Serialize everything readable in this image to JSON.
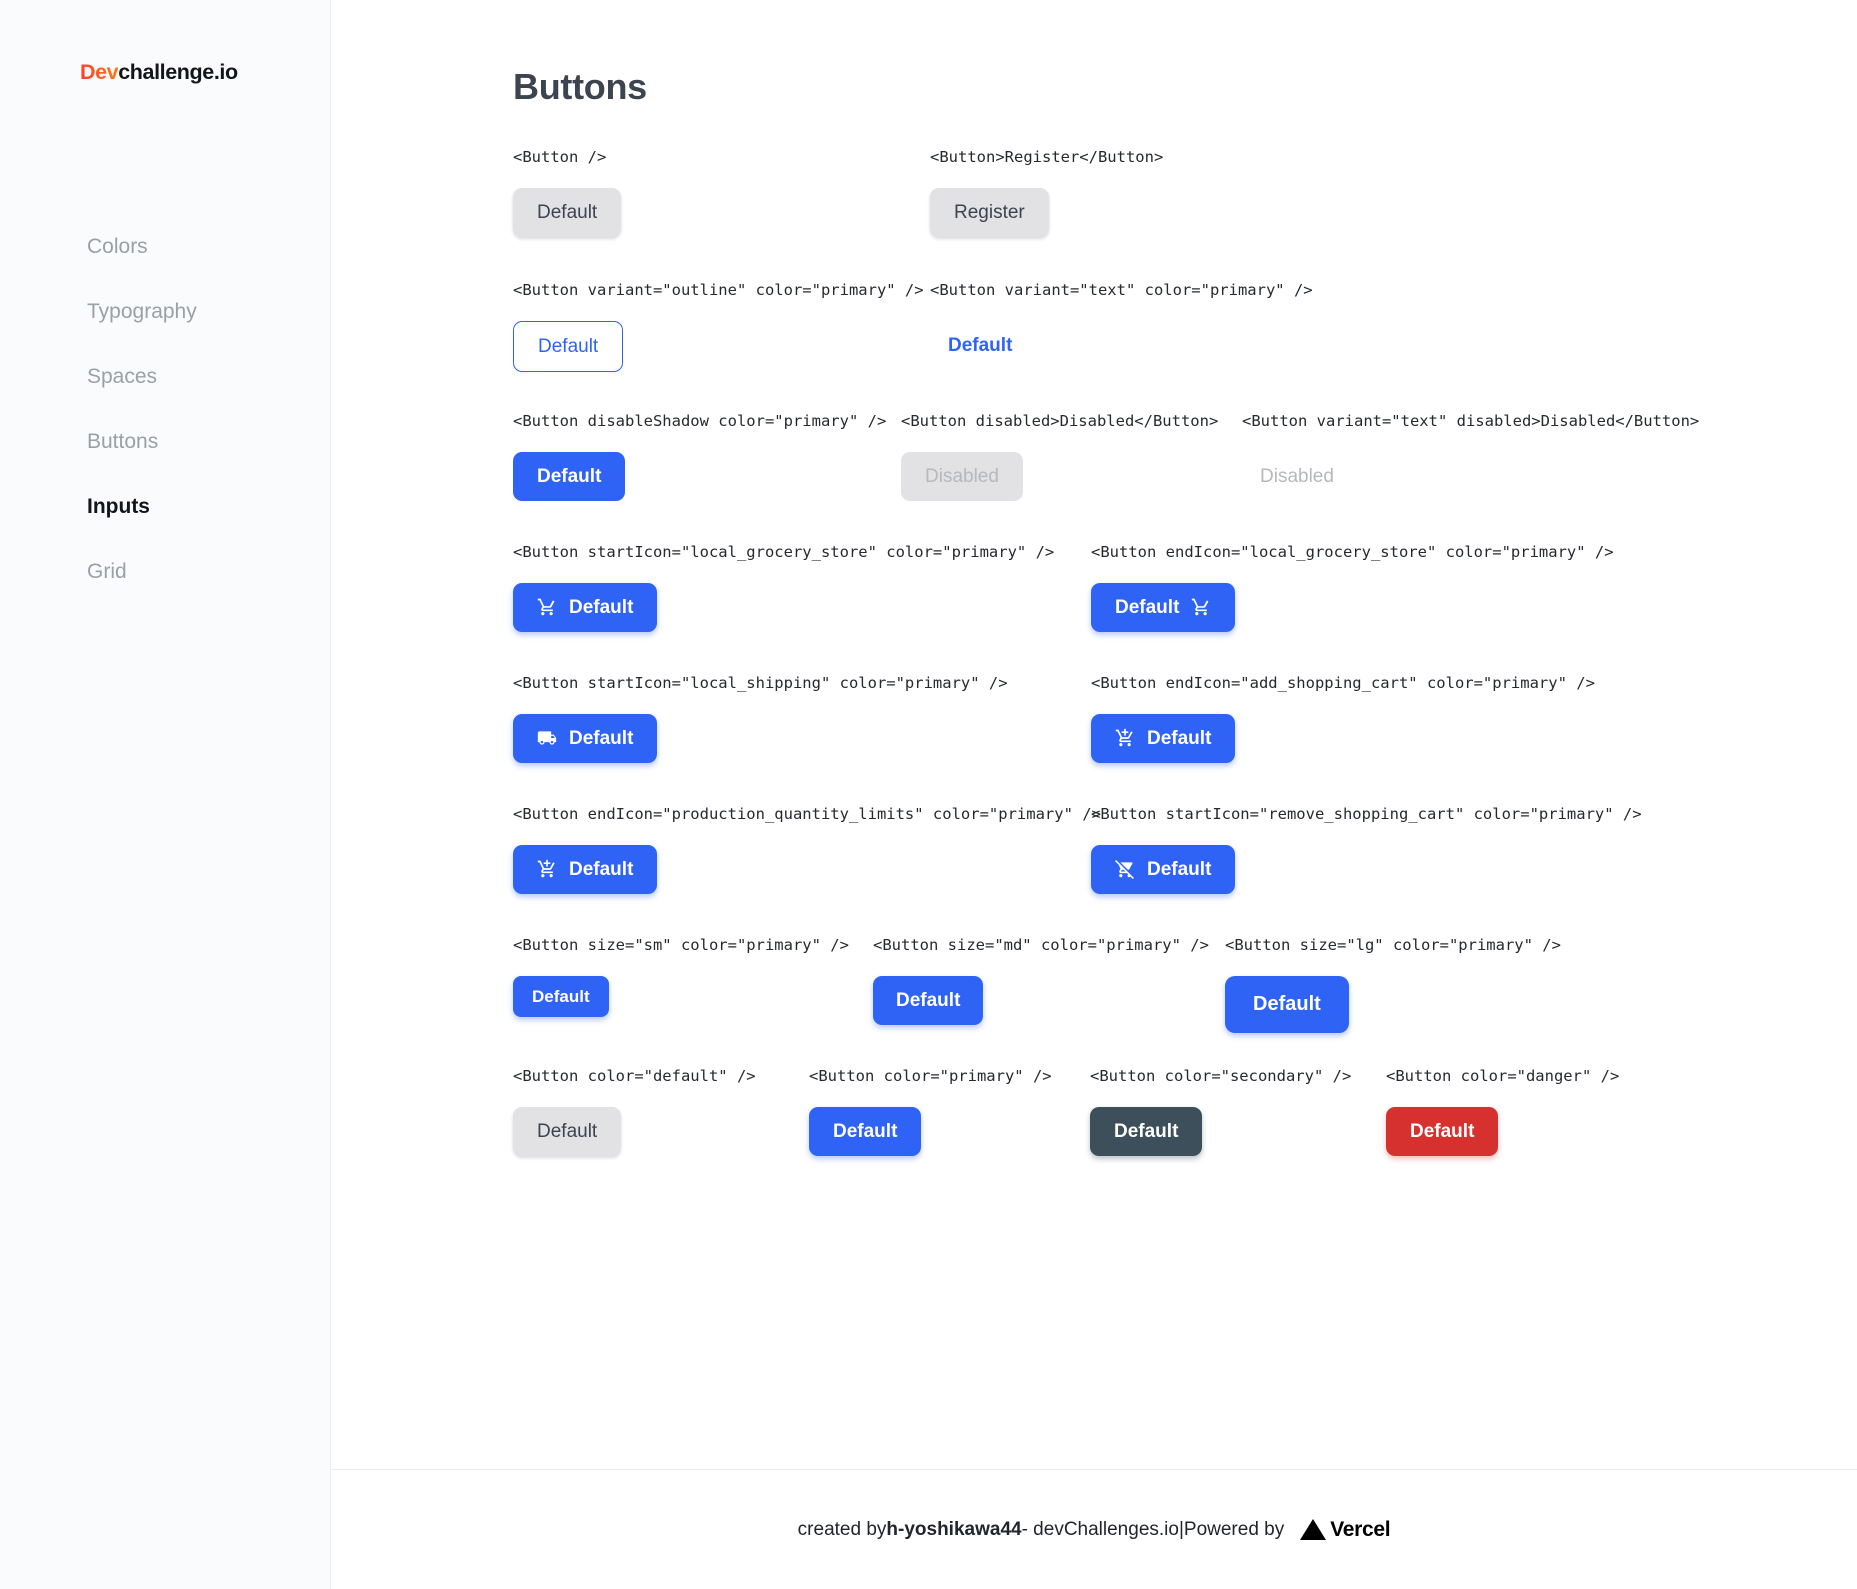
{
  "sidebar": {
    "logo": {
      "accent_text": "Dev",
      "rest_text": "challenge.io",
      "accent_color": "#ff5024"
    },
    "items": [
      {
        "label": "Colors",
        "active": false
      },
      {
        "label": "Typography",
        "active": false
      },
      {
        "label": "Spaces",
        "active": false
      },
      {
        "label": "Buttons",
        "active": false
      },
      {
        "label": "Inputs",
        "active": true
      },
      {
        "label": "Grid",
        "active": false
      }
    ]
  },
  "main": {
    "title": "Buttons",
    "rows": [
      {
        "cells": [
          {
            "code": "<Button />",
            "button": {
              "label": "Default",
              "style": "default",
              "icon": null,
              "icon_pos": null
            }
          },
          {
            "code": "<Button>Register</Button>",
            "button": {
              "label": "Register",
              "style": "default",
              "icon": null,
              "icon_pos": null
            }
          }
        ]
      },
      {
        "cells": [
          {
            "code": "<Button variant=\"outline\" color=\"primary\" />",
            "button": {
              "label": "Default",
              "style": "outline",
              "icon": null,
              "icon_pos": null
            }
          },
          {
            "code": "<Button variant=\"text\" color=\"primary\" />",
            "button": {
              "label": "Default",
              "style": "text",
              "icon": null,
              "icon_pos": null
            }
          }
        ]
      },
      {
        "cells": [
          {
            "code": "<Button disableShadow color=\"primary\" />",
            "button": {
              "label": "Default",
              "style": "primary-noshadow",
              "icon": null,
              "icon_pos": null
            }
          },
          {
            "code": "<Button disabled>Disabled</Button>",
            "button": {
              "label": "Disabled",
              "style": "disabled",
              "icon": null,
              "icon_pos": null
            }
          },
          {
            "code": "<Button variant=\"text\" disabled>Disabled</Button>",
            "button": {
              "label": "Disabled",
              "style": "text-disabled",
              "icon": null,
              "icon_pos": null
            }
          }
        ]
      },
      {
        "cells": [
          {
            "code": "<Button startIcon=\"local_grocery_store\" color=\"primary\" />",
            "button": {
              "label": "Default",
              "style": "primary",
              "icon": "shopping-cart-icon",
              "icon_pos": "start"
            }
          },
          {
            "code": "<Button endIcon=\"local_grocery_store\" color=\"primary\" />",
            "button": {
              "label": "Default",
              "style": "primary",
              "icon": "shopping-cart-icon",
              "icon_pos": "end"
            }
          }
        ]
      },
      {
        "cells": [
          {
            "code": "<Button startIcon=\"local_shipping\" color=\"primary\" />",
            "button": {
              "label": "Default",
              "style": "primary",
              "icon": "local-shipping-icon",
              "icon_pos": "start"
            }
          },
          {
            "code": "<Button endIcon=\"add_shopping_cart\" color=\"primary\" />",
            "button": {
              "label": "Default",
              "style": "primary",
              "icon": "add-shopping-cart-icon",
              "icon_pos": "start"
            }
          }
        ]
      },
      {
        "cells": [
          {
            "code": "<Button endIcon=\"production_quantity_limits\" color=\"primary\" />",
            "button": {
              "label": "Default",
              "style": "primary",
              "icon": "production-quantity-limits-icon",
              "icon_pos": "start"
            }
          },
          {
            "code": "<Button startIcon=\"remove_shopping_cart\" color=\"primary\" />",
            "button": {
              "label": "Default",
              "style": "primary",
              "icon": "remove-shopping-cart-icon",
              "icon_pos": "start"
            }
          }
        ]
      },
      {
        "cells": [
          {
            "code": "<Button size=\"sm\" color=\"primary\" />",
            "button": {
              "label": "Default",
              "style": "primary",
              "size": "sm",
              "icon": null,
              "icon_pos": null
            }
          },
          {
            "code": "<Button size=\"md\" color=\"primary\" />",
            "button": {
              "label": "Default",
              "style": "primary",
              "size": "md",
              "icon": null,
              "icon_pos": null
            }
          },
          {
            "code": "<Button size=\"lg\" color=\"primary\" />",
            "button": {
              "label": "Default",
              "style": "primary",
              "size": "lg",
              "icon": null,
              "icon_pos": null
            }
          }
        ]
      },
      {
        "cells": [
          {
            "code": "<Button color=\"default\" />",
            "button": {
              "label": "Default",
              "style": "default",
              "icon": null,
              "icon_pos": null
            }
          },
          {
            "code": "<Button color=\"primary\" />",
            "button": {
              "label": "Default",
              "style": "primary",
              "icon": null,
              "icon_pos": null
            }
          },
          {
            "code": "<Button color=\"secondary\" />",
            "button": {
              "label": "Default",
              "style": "secondary",
              "icon": null,
              "icon_pos": null
            }
          },
          {
            "code": "<Button color=\"danger\" />",
            "button": {
              "label": "Default",
              "style": "danger",
              "icon": null,
              "icon_pos": null
            }
          }
        ]
      }
    ]
  },
  "footer": {
    "created_by_prefix": "created by ",
    "author": "h-yoshikawa44",
    "site": " - devChallenges.io ",
    "divider": "| ",
    "powered_by": "Powered by ",
    "vercel": "Vercel"
  },
  "colors": {
    "primary": "#2f63f5",
    "secondary": "#3d4f5a",
    "danger": "#d6312f",
    "default": "#e2e2e4",
    "disabled_text": "#b6b8bc",
    "logo_accent": "#ff5024"
  }
}
